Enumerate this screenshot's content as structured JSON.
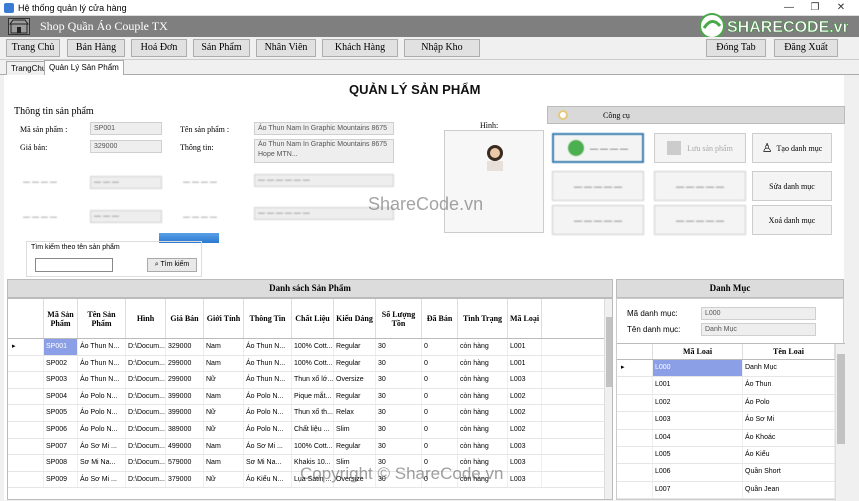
{
  "window": {
    "title": "Hệ thống quản lý cửa hàng",
    "min": "—",
    "max": "❐",
    "close": "✕"
  },
  "brand": {
    "name": "Shop Quần Áo Couple TX",
    "watermark_logo": "SHARECODE.vn"
  },
  "nav": {
    "items": [
      "Trang Chủ",
      "Bán Hàng",
      "Hoá Đơn",
      "Sản Phẩm",
      "Nhân Viên",
      "Khách Hàng",
      "Nhập Kho"
    ],
    "close_tab": "Đóng Tab",
    "logout": "Đăng Xuất"
  },
  "tabs": [
    "TrangChu",
    "Quản Lý Sản Phẩm"
  ],
  "main": {
    "title": "QUẢN LÝ SẢN PHẨM",
    "section": "Thông tin  sản phẩm",
    "image_label": "Hình:"
  },
  "form": {
    "ma_sp_label": "Mã sản phẩm :",
    "ma_sp": "SP001",
    "gia_ban_label": "Giá bán:",
    "gia_ban": "329000",
    "ten_sp_label": "Tên sản phẩm :",
    "ten_sp": "Áo Thun Nam In Graphic Mountains 8675",
    "thong_tin_label": "Thông tin:",
    "thong_tin": "Áo Thun Nam In Graphic Mountains 8675 Hope MTN..."
  },
  "tools": {
    "header": "Công cụ",
    "save": "Lưu sản phẩm",
    "create_category": "Tạo danh mục",
    "edit_category": "Sửa danh mục",
    "delete_category": "Xoá danh mục"
  },
  "search": {
    "label": "Tìm kiếm theo tên sản phẩm",
    "button": "Tìm kiếm",
    "value": ""
  },
  "products": {
    "caption": "Danh sách Sản Phẩm",
    "columns": [
      "Mã Sản Phẩm",
      "Tên Sản Phẩm",
      "Hình",
      "Giá Bán",
      "Giới Tính",
      "Thông Tin",
      "Chất Liệu",
      "Kiểu Dáng",
      "Số Lượng Tồn",
      "Đã Bán",
      "Tình Trạng",
      "Mã Loại"
    ],
    "rows": [
      [
        "SP001",
        "Áo Thun N...",
        "D:\\Docum...",
        "329000",
        "Nam",
        "Áo Thun N...",
        "100% Cott...",
        "Regular",
        "30",
        "0",
        "còn hàng",
        "L001"
      ],
      [
        "SP002",
        "Áo Thun N...",
        "D:\\Docum...",
        "299000",
        "Nam",
        "Áo Thun N...",
        "100% Cott...",
        "Regular",
        "30",
        "0",
        "còn hàng",
        "L001"
      ],
      [
        "SP003",
        "Áo Thun N...",
        "D:\\Docum...",
        "299000",
        "Nữ",
        "Áo Thun N...",
        "Thun xố lớ...",
        "Oversize",
        "30",
        "0",
        "còn hàng",
        "L003"
      ],
      [
        "SP004",
        "Áo Polo N...",
        "D:\\Docum...",
        "399000",
        "Nam",
        "Áo Polo N...",
        "Pique mắt...",
        "Regular",
        "30",
        "0",
        "còn hàng",
        "L002"
      ],
      [
        "SP005",
        "Áo Polo N...",
        "D:\\Docum...",
        "399000",
        "Nữ",
        "Áo Polo N...",
        "Thun xố th...",
        "Relax",
        "30",
        "0",
        "còn hàng",
        "L002"
      ],
      [
        "SP006",
        "Áo Polo N...",
        "D:\\Docum...",
        "389000",
        "Nữ",
        "Áo Polo N...",
        "Chất liệu ...",
        "Slim",
        "30",
        "0",
        "còn hàng",
        "L002"
      ],
      [
        "SP007",
        "Áo Sơ Mi ...",
        "D:\\Docum...",
        "499000",
        "Nam",
        "Áo Sơ Mi ...",
        "100% Cott...",
        "Regular",
        "30",
        "0",
        "còn hàng",
        "L003"
      ],
      [
        "SP008",
        "Sơ Mi Na...",
        "D:\\Docum...",
        "579000",
        "Nam",
        "Sơ Mi Na...",
        "Khakis 10...",
        "Slim",
        "30",
        "0",
        "còn hàng",
        "L003"
      ],
      [
        "SP009",
        "Áo Sơ Mi ...",
        "D:\\Docum...",
        "379000",
        "Nữ",
        "Áo Kiểu N...",
        "Lụa Satin ...",
        "Oversize",
        "30",
        "0",
        "còn hàng",
        "L003"
      ]
    ]
  },
  "category": {
    "caption": "Danh Mục",
    "ma_label": "Mã danh mục:",
    "ma_value": "L000",
    "ten_label": "Tên danh mục:",
    "ten_value": "Danh Mục",
    "columns": [
      "Mã Loai",
      "Tên Loai"
    ],
    "rows": [
      [
        "L000",
        "Danh Mục"
      ],
      [
        "L001",
        "Áo Thun"
      ],
      [
        "L002",
        "Áo Polo"
      ],
      [
        "L003",
        "Áo Sơ Mi"
      ],
      [
        "L004",
        "Áo Khoác"
      ],
      [
        "L005",
        "Áo Kiểu"
      ],
      [
        "L006",
        "Quần Short"
      ],
      [
        "L007",
        "Quần Jean"
      ]
    ]
  },
  "watermarks": {
    "center": "ShareCode.vn",
    "footer": "Copyright © ShareCode.vn"
  },
  "colors": {
    "brand_bar": "#7f7f7f",
    "selected_row": "#8b9fe6",
    "caption_bg": "#dcdcdc"
  }
}
